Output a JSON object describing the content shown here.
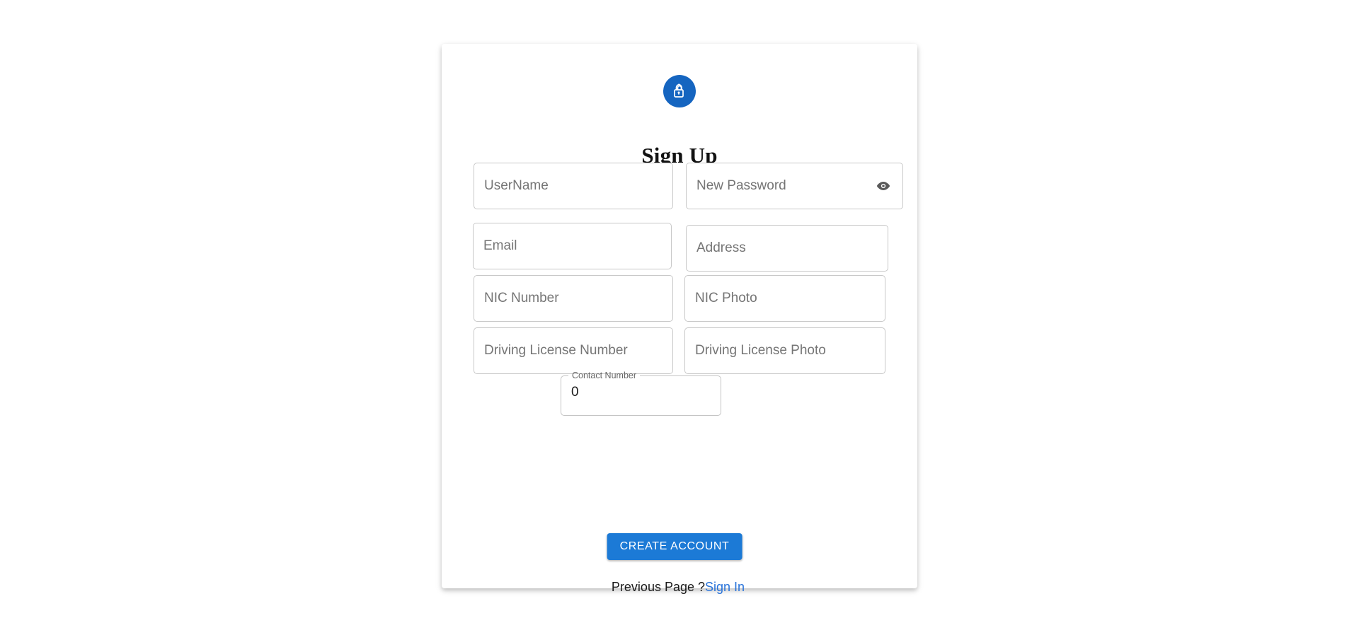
{
  "card": {
    "icon": "open-lock-icon",
    "icon_bg_color": "#1565c0",
    "title": "Sign Up"
  },
  "form": {
    "fields": [
      {
        "name": "username",
        "placeholder": "UserName"
      },
      {
        "name": "new-password",
        "placeholder": "New Password",
        "toggle_icon": "eye-icon"
      },
      {
        "name": "email",
        "placeholder": "Email"
      },
      {
        "name": "address",
        "placeholder": "Address"
      },
      {
        "name": "nic-number",
        "placeholder": "NIC Number"
      },
      {
        "name": "nic-photo",
        "placeholder": "NIC Photo"
      },
      {
        "name": "driving-license-number",
        "placeholder": "Driving License Number"
      },
      {
        "name": "driving-license-photo",
        "placeholder": "Driving License Photo"
      }
    ],
    "contact_number": {
      "label": "Contact Number",
      "value": "0"
    }
  },
  "actions": {
    "submit_label": "CREATE ACCOUNT",
    "submit_color": "#1c7ad6"
  },
  "footer": {
    "prompt": "Previous Page ?",
    "link_label": "Sign In",
    "link_color": "#2a74da"
  }
}
